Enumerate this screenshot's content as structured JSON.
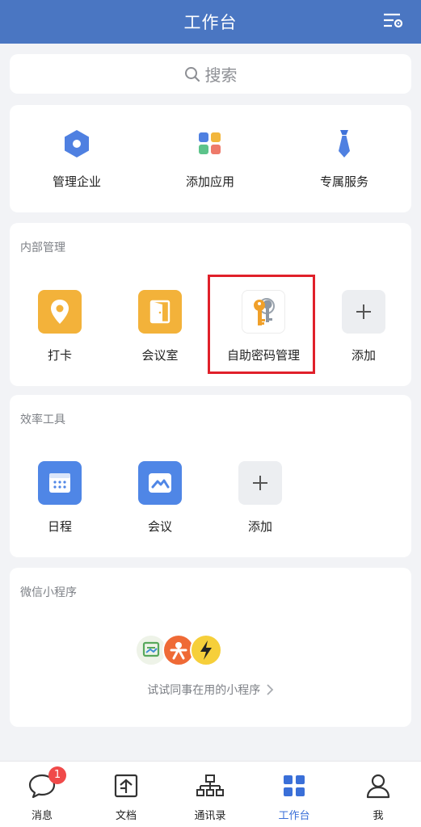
{
  "header": {
    "title": "工作台"
  },
  "search": {
    "placeholder": "搜索"
  },
  "quick_actions": [
    {
      "label": "管理企业",
      "icon": "hexagon-icon"
    },
    {
      "label": "添加应用",
      "icon": "app-grid-icon"
    },
    {
      "label": "专属服务",
      "icon": "tie-icon"
    }
  ],
  "internal": {
    "title": "内部管理",
    "apps": [
      {
        "label": "打卡",
        "icon": "location-pin-icon"
      },
      {
        "label": "会议室",
        "icon": "door-icon"
      },
      {
        "label": "自助密码管理",
        "icon": "key-icon"
      },
      {
        "label": "添加",
        "icon": "plus-icon"
      }
    ]
  },
  "efficiency": {
    "title": "效率工具",
    "apps": [
      {
        "label": "日程",
        "icon": "calendar-icon"
      },
      {
        "label": "会议",
        "icon": "meeting-icon"
      },
      {
        "label": "添加",
        "icon": "plus-icon"
      }
    ]
  },
  "mini_programs": {
    "title": "微信小程序",
    "hint": "试试同事在用的小程序",
    "icons": [
      "green-form-icon",
      "orange-person-icon",
      "lightning-icon"
    ]
  },
  "tabbar": {
    "items": [
      {
        "label": "消息",
        "icon": "chat-bubble-icon",
        "badge": "1"
      },
      {
        "label": "文档",
        "icon": "document-icon"
      },
      {
        "label": "通讯录",
        "icon": "org-chart-icon"
      },
      {
        "label": "工作台",
        "icon": "workbench-grid-icon",
        "active": true
      },
      {
        "label": "我",
        "icon": "person-icon"
      }
    ]
  },
  "colors": {
    "header": "#4a76c2",
    "accent": "#3a6fd8",
    "highlight_border": "#e0202a",
    "badge": "#f04a4a"
  }
}
